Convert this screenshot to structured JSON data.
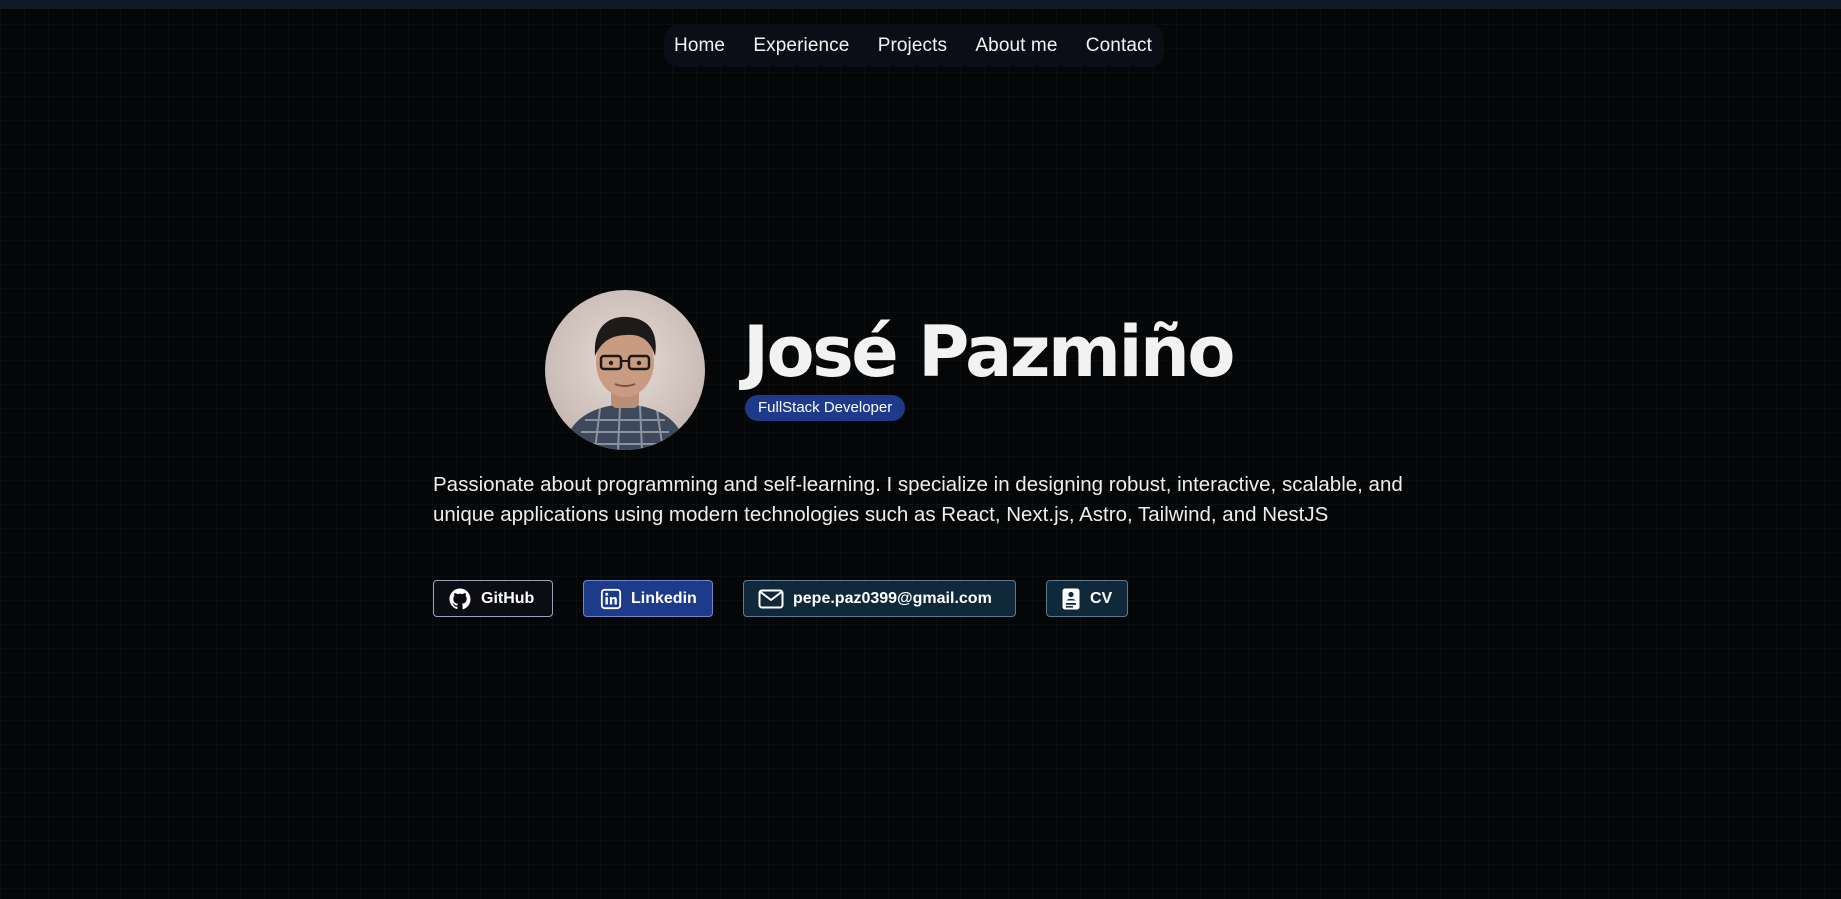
{
  "nav": {
    "items": [
      {
        "label": "Home"
      },
      {
        "label": "Experience"
      },
      {
        "label": "Projects"
      },
      {
        "label": "About me"
      },
      {
        "label": "Contact"
      }
    ]
  },
  "hero": {
    "name": "José Pazmiño",
    "role": "FullStack Developer",
    "bio": "Passionate about programming and self-learning. I specialize in designing robust, interactive, scalable, and unique applications using modern technologies such as React, Next.js, Astro, Tailwind, and NestJS"
  },
  "social": {
    "github": {
      "label": "GitHub",
      "icon": "github-icon"
    },
    "linkedin": {
      "label": "Linkedin",
      "icon": "linkedin-icon"
    },
    "email": {
      "label": "pepe.paz0399@gmail.com",
      "icon": "mail-icon"
    },
    "cv": {
      "label": "CV",
      "icon": "document-icon"
    }
  },
  "colors": {
    "background": "#050607",
    "badge": "#1e3a8a",
    "linkedin_button": "#1e3a8a",
    "contact_button": "#10293a"
  }
}
